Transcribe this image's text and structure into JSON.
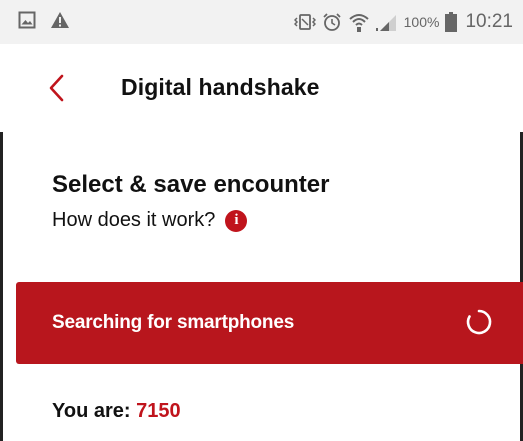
{
  "status_bar": {
    "battery_percent": "100%",
    "time": "10:21",
    "icons": [
      "gallery-icon",
      "warning-icon",
      "vibrate-icon",
      "alarm-icon",
      "wifi-icon",
      "signal-icon",
      "battery-icon"
    ]
  },
  "app_bar": {
    "title": "Digital handshake",
    "back_icon": "chevron-left-icon"
  },
  "section": {
    "title": "Select & save encounter",
    "help_link": "How does it work?",
    "help_icon": "info-icon"
  },
  "search_banner": {
    "text": "Searching for smartphones",
    "spinner_icon": "loading-spinner-icon"
  },
  "identity": {
    "label": "You are:",
    "code": "7150"
  },
  "colors": {
    "accent": "#b8161d",
    "status_bar_bg": "#f2f2f2",
    "text": "#111111"
  }
}
